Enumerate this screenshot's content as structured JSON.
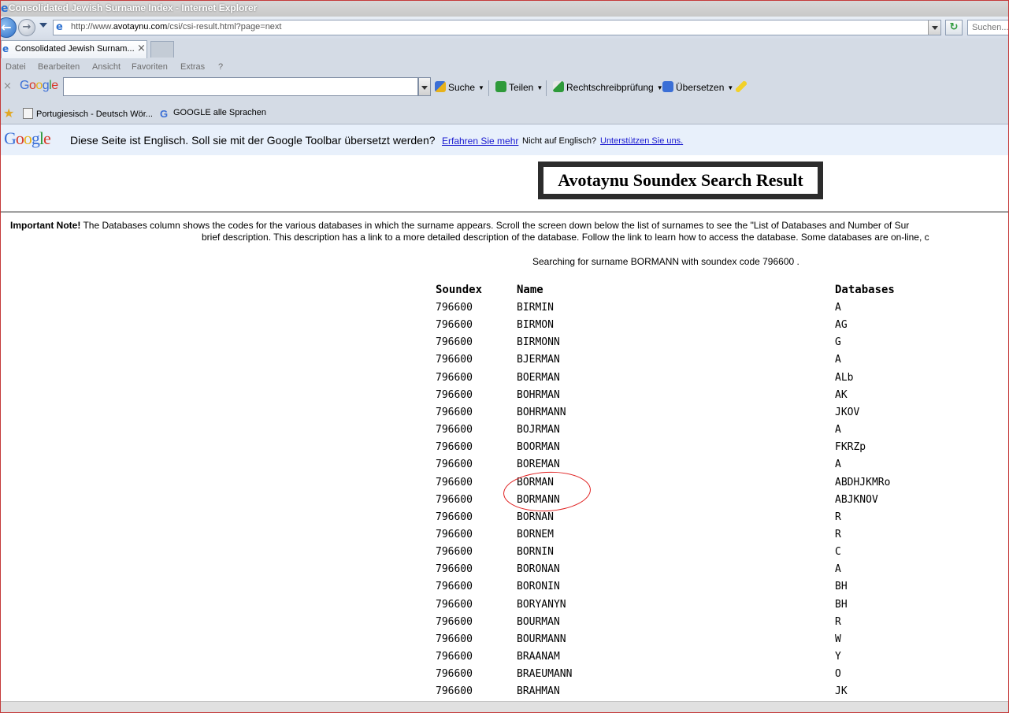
{
  "window": {
    "title": "Consolidated Jewish Surname Index - Internet Explorer"
  },
  "address_bar": {
    "url_prefix": "http://www.",
    "url_domain": "avotaynu.com",
    "url_path": "/csi/csi-result.html?page=next",
    "search_placeholder": "Suchen..."
  },
  "tab": {
    "label": "Consolidated Jewish Surnam...",
    "close": "×"
  },
  "menu": [
    "Datei",
    "Bearbeiten",
    "Ansicht",
    "Favoriten",
    "Extras",
    "?"
  ],
  "google_toolbar": {
    "logo": "Google",
    "search_label": "Suche",
    "share_label": "Teilen",
    "spell_label": "Rechtschreibprüfung",
    "translate_label": "Übersetzen"
  },
  "favorites": {
    "item1": "Portugiesisch - Deutsch Wör...",
    "item2": "GOOGLE alle Sprachen"
  },
  "translate_bar": {
    "logo": "Google",
    "message": "Diese Seite ist Englisch. Soll sie mit der Google Toolbar übersetzt werden?",
    "learn_more": "Erfahren Sie mehr",
    "not_english": "Nicht auf Englisch?",
    "support": "Unterstützen Sie uns."
  },
  "page": {
    "banner_title": "Avotaynu Soundex Search Result",
    "note_bold": "Important Note!",
    "note_line1": "The Databases column shows the codes for the various databases in which the surname appears. Scroll the screen down below the list of surnames to see the \"List of Databases and Number of Sur",
    "note_line2": "brief description. This description has a link to a more detailed description of the database. Follow the link to learn how to access the database. Some databases are on-line, c",
    "searching": "Searching for surname BORMANN with soundex code 796600 ."
  },
  "results": {
    "headers": {
      "soundex": "Soundex",
      "name": "Name",
      "databases": "Databases"
    },
    "rows": [
      {
        "soundex": "796600",
        "name": "BIRMIN",
        "databases": "A"
      },
      {
        "soundex": "796600",
        "name": "BIRMON",
        "databases": "AG"
      },
      {
        "soundex": "796600",
        "name": "BIRMONN",
        "databases": "G"
      },
      {
        "soundex": "796600",
        "name": "BJERMAN",
        "databases": "A"
      },
      {
        "soundex": "796600",
        "name": "BOERMAN",
        "databases": "ALb"
      },
      {
        "soundex": "796600",
        "name": "BOHRMAN",
        "databases": "AK"
      },
      {
        "soundex": "796600",
        "name": "BOHRMANN",
        "databases": "JKOV"
      },
      {
        "soundex": "796600",
        "name": "BOJRMAN",
        "databases": "A"
      },
      {
        "soundex": "796600",
        "name": "BOORMAN",
        "databases": "FKRZp"
      },
      {
        "soundex": "796600",
        "name": "BOREMAN",
        "databases": "A"
      },
      {
        "soundex": "796600",
        "name": "BORMAN",
        "databases": "ABDHJKMRo"
      },
      {
        "soundex": "796600",
        "name": "BORMANN",
        "databases": "ABJKNOV"
      },
      {
        "soundex": "796600",
        "name": "BORNAN",
        "databases": "R"
      },
      {
        "soundex": "796600",
        "name": "BORNEM",
        "databases": "R"
      },
      {
        "soundex": "796600",
        "name": "BORNIN",
        "databases": "C"
      },
      {
        "soundex": "796600",
        "name": "BORONAN",
        "databases": "A"
      },
      {
        "soundex": "796600",
        "name": "BORONIN",
        "databases": "BH"
      },
      {
        "soundex": "796600",
        "name": "BORYANYN",
        "databases": "BH"
      },
      {
        "soundex": "796600",
        "name": "BOURMAN",
        "databases": "R"
      },
      {
        "soundex": "796600",
        "name": "BOURMANN",
        "databases": "W"
      },
      {
        "soundex": "796600",
        "name": "BRAANAM",
        "databases": "Y"
      },
      {
        "soundex": "796600",
        "name": "BRAEUMANN",
        "databases": "O"
      },
      {
        "soundex": "796600",
        "name": "BRAHMAN",
        "databases": "JK"
      }
    ]
  },
  "colors": {
    "accent_link": "#1a1ad0",
    "annotation_circle": "#e02020",
    "frame_border": "#c43a3a"
  }
}
